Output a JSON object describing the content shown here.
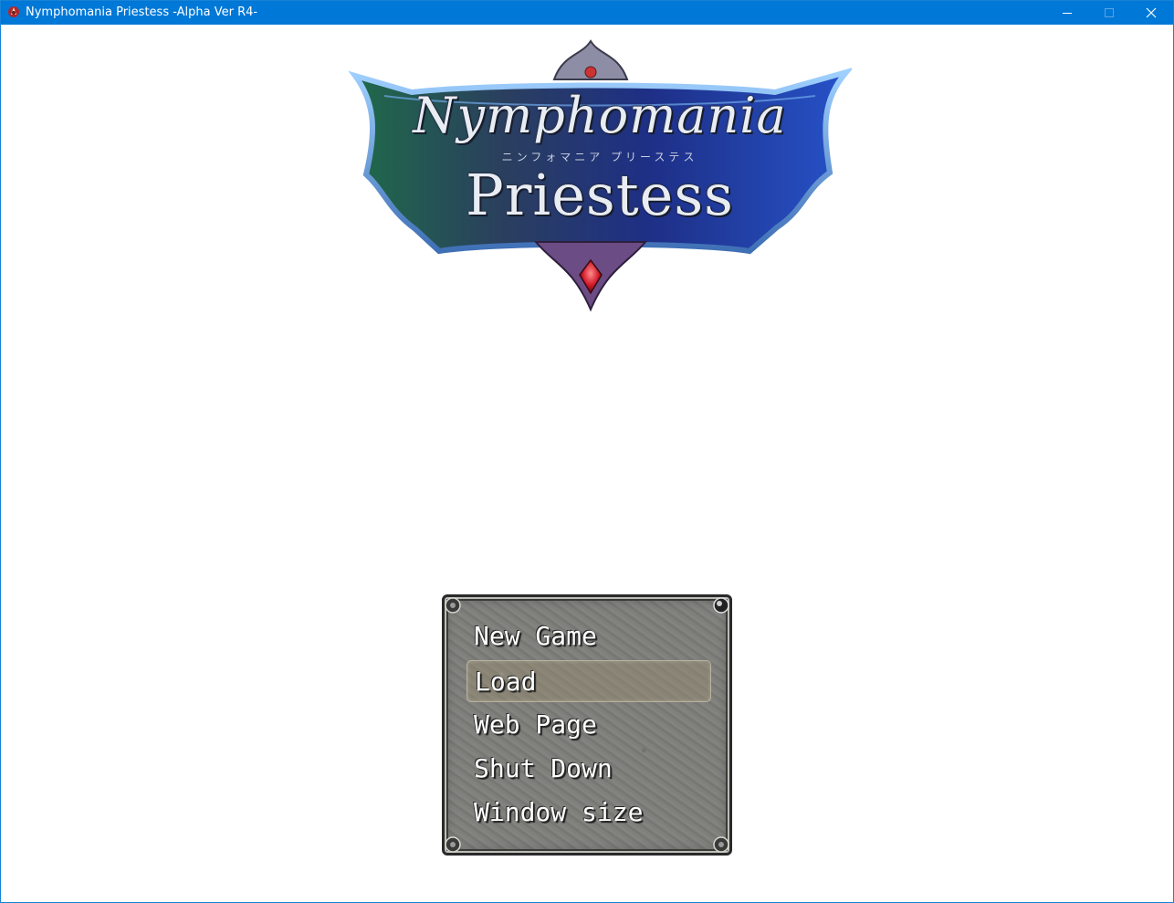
{
  "window": {
    "title": "Nymphomania Priestess -Alpha Ver R4-",
    "accent_color": "#0078d7",
    "controls": [
      "minimize-icon",
      "maximize-icon",
      "close-icon"
    ]
  },
  "logo": {
    "line1": "Nymphomania",
    "subtitle": "ニンフォマニア プリーステス",
    "line2": "Priestess"
  },
  "menu": {
    "items": [
      {
        "label": "New Game",
        "selected": false
      },
      {
        "label": "Load",
        "selected": true
      },
      {
        "label": "Web Page",
        "selected": false
      },
      {
        "label": "Shut Down",
        "selected": false
      },
      {
        "label": "Window size",
        "selected": false
      }
    ]
  }
}
